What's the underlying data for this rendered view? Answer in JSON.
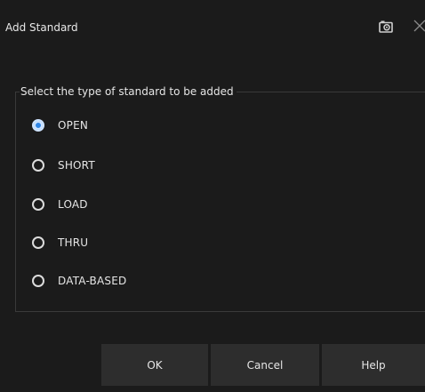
{
  "window": {
    "title": "Add Standard",
    "icons": [
      "camera-icon",
      "close-icon"
    ]
  },
  "group": {
    "legend": "Select the type of standard to be added",
    "selected": "OPEN",
    "options": [
      {
        "label": "OPEN",
        "checked": true
      },
      {
        "label": "SHORT",
        "checked": false
      },
      {
        "label": "LOAD",
        "checked": false
      },
      {
        "label": "THRU",
        "checked": false
      },
      {
        "label": "DATA-BASED",
        "checked": false
      }
    ]
  },
  "buttons": {
    "ok": "OK",
    "cancel": "Cancel",
    "help": "Help"
  },
  "colors": {
    "background": "#1b1b1b",
    "button": "#2d2d2d",
    "radio_selected": "#2f86e6",
    "text": "#e6e6e6"
  }
}
